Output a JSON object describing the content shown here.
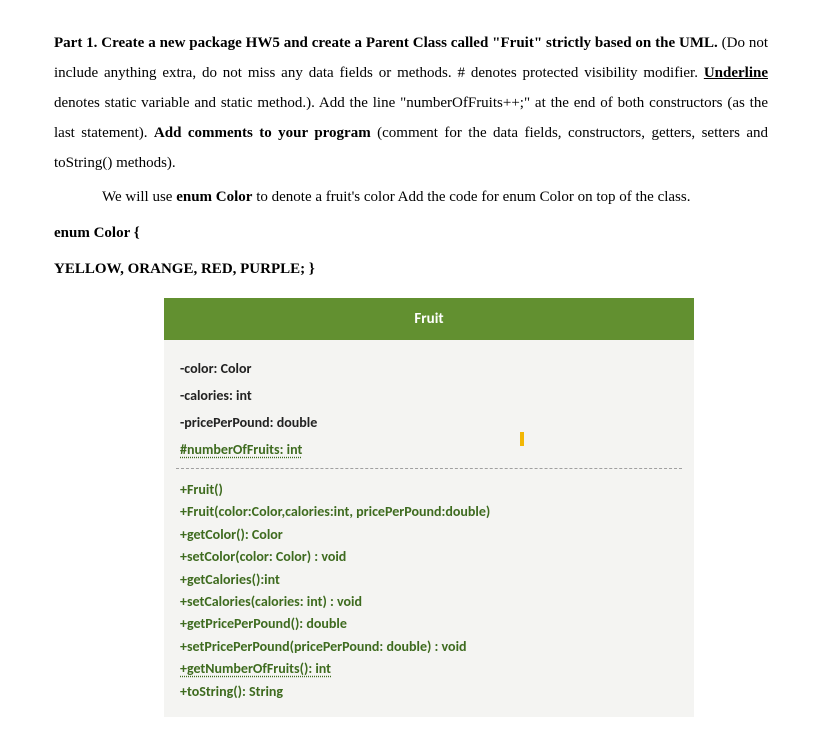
{
  "problem": {
    "p1_lead": "Part 1. Create a new package HW5 and create a Parent Class called \"Fruit\" strictly based on the UML.",
    "p1_body1": " (Do not include anything extra, do not miss any data fields or methods. # denotes protected visibility modifier. ",
    "p1_uline": "Underline",
    "p1_body2": " denotes static variable and static method.). Add the line \"numberOfFruits++;\" at the end of both constructors (as the last statement). ",
    "p1_bold2": "Add comments to your program",
    "p1_body3": " (comment for the data fields, constructors, getters, setters and toString() methods).",
    "p2_a": "We will use ",
    "p2_bold": "enum Color",
    "p2_b": " to denote a fruit's color Add the code for enum Color on top of the class.",
    "enum_line1": "enum Color {",
    "enum_line2": "YELLOW, ORANGE, RED, PURPLE; }"
  },
  "uml": {
    "title": "Fruit",
    "attributes": [
      "-color: Color",
      "-calories: int",
      "-pricePerPound: double"
    ],
    "static_attribute": "#numberOfFruits: int",
    "methods": [
      "+Fruit()",
      "+Fruit(color:Color,calories:int, pricePerPound:double)",
      "+getColor(): Color",
      "+setColor(color: Color) : void",
      "+getCalories():int",
      "+setCalories(calories: int) : void",
      "+getPricePerPound(): double",
      "+setPricePerPound(pricePerPound: double) : void"
    ],
    "static_method": "+getNumberOfFruits(): int",
    "tostring_method": "+toString(): String"
  }
}
